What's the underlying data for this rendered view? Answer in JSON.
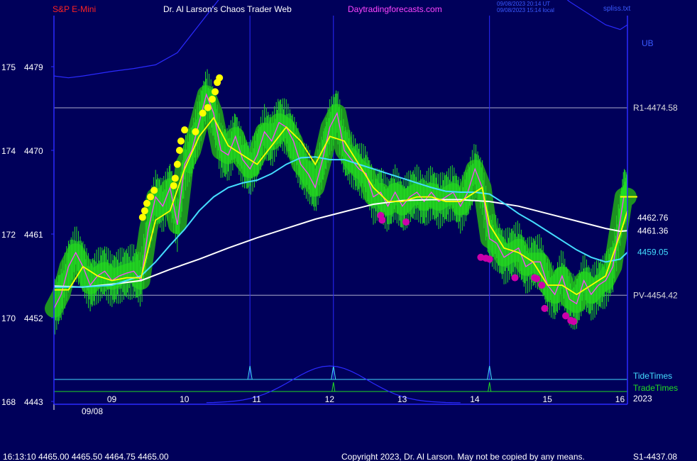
{
  "header": {
    "symbol": "S&P E-Mini",
    "site_title": "Dr. Al Larson's Chaos Trader Web",
    "site_url": "Daytradingforecasts.com",
    "timestamp_utc": "09/08/2023 20:14 UT",
    "timestamp_local": "09/08/2023 15:14 local",
    "file_name": "spliss.txt"
  },
  "footer": {
    "quote": "16:13:10  4465.00  4465.50  4464.75  4465.00",
    "copyright": "Copyright 2023, Dr. Al Larson. May not be copied by any means.",
    "s1_label": "S1-4437.08"
  },
  "colors": {
    "background": "#00005a",
    "frame": "#2a2aff",
    "green_band": "#1f9a1f",
    "price_bar": "#22dd22",
    "fast_ma": "#ffff00",
    "mid_ma": "#44ddff",
    "slow_ma": "#ffffff",
    "pink_ma": "#ff44ff",
    "yellow_dot": "#ffff00",
    "magenta_dot": "#cc00aa",
    "ub_line": "#2a2aff",
    "tide_line": "#44ddff",
    "trade_line": "#22dd22"
  },
  "chart_data": {
    "type": "line",
    "title": "S&P E-Mini",
    "xlabel": "",
    "ylabel": "",
    "date_label": "09/08",
    "year_label": "2023",
    "x_ticks": [
      "09",
      "10",
      "11",
      "12",
      "13",
      "14",
      "15",
      "16"
    ],
    "y_ticks": [
      {
        "left": "175",
        "right": "4479",
        "price": 4479
      },
      {
        "left": "174",
        "right": "4470",
        "price": 4470
      },
      {
        "left": "172",
        "right": "4461",
        "price": 4461
      },
      {
        "left": "170",
        "right": "4452",
        "price": 4452
      },
      {
        "left": "168",
        "right": "4443",
        "price": 4443
      }
    ],
    "ylim": [
      4443,
      4480.5
    ],
    "xlim": [
      8.2,
      16.1
    ],
    "levels": [
      {
        "label": "R1-4474.58",
        "price": 4474.58
      },
      {
        "label": "PV-4454.42",
        "price": 4454.42
      }
    ],
    "ma_labels": [
      {
        "label": "4462.76",
        "price": 4462.76,
        "color": "#ffffff"
      },
      {
        "label": "4461.36",
        "price": 4461.36,
        "color": "#ffffff"
      },
      {
        "label": "4459.05",
        "price": 4459.05,
        "color": "#44ddff"
      }
    ],
    "band_label": "UB",
    "tide_label": "TideTimes",
    "trade_label": "TradeTimes",
    "tide_times": [
      10.9,
      12.05,
      14.2
    ],
    "trade_times": [
      12.05,
      14.2
    ],
    "series": [
      {
        "name": "price",
        "x": [
          8.2,
          8.3,
          8.4,
          8.5,
          8.6,
          8.7,
          8.8,
          8.9,
          9.0,
          9.1,
          9.2,
          9.3,
          9.4,
          9.5,
          9.6,
          9.7,
          9.8,
          9.9,
          10.0,
          10.1,
          10.2,
          10.3,
          10.4,
          10.5,
          10.6,
          10.7,
          10.8,
          10.9,
          11.0,
          11.1,
          11.2,
          11.3,
          11.4,
          11.5,
          11.6,
          11.7,
          11.8,
          11.9,
          12.0,
          12.1,
          12.2,
          12.3,
          12.4,
          12.5,
          12.6,
          12.7,
          12.8,
          12.9,
          13.0,
          13.1,
          13.2,
          13.3,
          13.4,
          13.5,
          13.6,
          13.7,
          13.8,
          13.9,
          14.0,
          14.1,
          14.2,
          14.3,
          14.4,
          14.5,
          14.6,
          14.7,
          14.8,
          14.9,
          15.0,
          15.1,
          15.2,
          15.3,
          15.4,
          15.5,
          15.6,
          15.7,
          15.8,
          15.9,
          16.0,
          16.05,
          16.1
        ],
        "y": [
          4453,
          4454.5,
          4457.5,
          4459,
          4457.5,
          4455.5,
          4456.5,
          4457,
          4456,
          4456.5,
          4456.8,
          4457,
          4456,
          4461.5,
          4465,
          4464,
          4466,
          4462,
          4468.5,
          4470,
          4473,
          4476,
          4474,
          4470,
          4469.5,
          4471.5,
          4469,
          4468,
          4469.5,
          4472,
          4471,
          4473,
          4472.5,
          4471,
          4468.5,
          4467.5,
          4466,
          4469,
          4472.5,
          4474,
          4470,
          4469,
          4468,
          4467.5,
          4465,
          4465.5,
          4464,
          4465.5,
          4464,
          4465,
          4465.5,
          4464.5,
          4465.5,
          4464.5,
          4465,
          4465.5,
          4464,
          4465.5,
          4468,
          4466,
          4460.5,
          4460,
          4458.5,
          4459,
          4459.5,
          4457.5,
          4458,
          4458,
          4455.5,
          4454.5,
          4456.5,
          4454,
          4453.5,
          4456,
          4454.5,
          4455.5,
          4456,
          4457.5,
          4462.5,
          4465,
          4465
        ],
        "color": "#22dd22"
      },
      {
        "name": "fast_ma",
        "x": [
          8.2,
          8.4,
          8.6,
          8.8,
          9.0,
          9.2,
          9.4,
          9.6,
          9.8,
          10.0,
          10.2,
          10.4,
          10.6,
          10.8,
          11.0,
          11.2,
          11.4,
          11.6,
          11.8,
          12.0,
          12.2,
          12.4,
          12.6,
          12.8,
          13.0,
          13.2,
          13.4,
          13.6,
          13.8,
          14.0,
          14.1,
          14.2,
          14.4,
          14.6,
          14.8,
          15.0,
          15.2,
          15.4,
          15.6,
          15.8,
          16.0,
          16.1
        ],
        "y": [
          4455,
          4455,
          4457.5,
          4456.5,
          4456,
          4456.3,
          4456.3,
          4462.5,
          4463.5,
          4468,
          4471.5,
          4473.5,
          4470.5,
          4469.5,
          4468.5,
          4470.5,
          4472.5,
          4471,
          4468.5,
          4471.5,
          4471,
          4468.5,
          4466,
          4464.5,
          4464.5,
          4465,
          4465,
          4464.5,
          4464.5,
          4465.5,
          4466,
          4462,
          4459.5,
          4459,
          4458,
          4455.5,
          4455.5,
          4454.5,
          4455.5,
          4456.5,
          4461,
          4463.5
        ],
        "color": "#ffff00"
      },
      {
        "name": "mid_ma",
        "x": [
          8.2,
          8.6,
          9.0,
          9.4,
          9.6,
          9.8,
          10.0,
          10.2,
          10.4,
          10.6,
          10.8,
          11.0,
          11.2,
          11.4,
          11.6,
          11.8,
          12.0,
          12.2,
          12.4,
          12.6,
          12.8,
          13.0,
          13.2,
          13.4,
          13.6,
          13.8,
          14.0,
          14.2,
          14.4,
          14.6,
          14.8,
          15.0,
          15.2,
          15.4,
          15.6,
          15.8,
          16.0,
          16.1
        ],
        "y": [
          4455.3,
          4455.3,
          4455.5,
          4456.5,
          4458,
          4459.8,
          4461.5,
          4463.5,
          4465,
          4466,
          4466.5,
          4466.8,
          4467.5,
          4468.5,
          4469.2,
          4469.3,
          4469,
          4469,
          4468.5,
          4468,
          4467.5,
          4467,
          4466.5,
          4466,
          4465.6,
          4465.5,
          4465.5,
          4465.3,
          4464.3,
          4463.2,
          4462.3,
          4461.3,
          4460.3,
          4459.3,
          4458.5,
          4458,
          4458.3,
          4459.05
        ],
        "color": "#44ddff"
      },
      {
        "name": "slow_ma",
        "x": [
          8.2,
          8.6,
          9.0,
          9.4,
          9.8,
          10.2,
          10.6,
          11.0,
          11.4,
          11.8,
          12.2,
          12.6,
          13.0,
          13.4,
          13.8,
          14.2,
          14.6,
          15.0,
          15.4,
          15.8,
          16.0,
          16.1
        ],
        "y": [
          4455.4,
          4455.3,
          4455.6,
          4456,
          4457.2,
          4458.3,
          4459.5,
          4460.6,
          4461.6,
          4462.6,
          4463.4,
          4464.2,
          4464.6,
          4464.7,
          4464.7,
          4464.5,
          4464,
          4463.2,
          4462.4,
          4461.6,
          4461.3,
          4461.36
        ],
        "color": "#ffffff"
      },
      {
        "name": "ub",
        "x": [
          8.2,
          8.4,
          8.6,
          9.0,
          9.3,
          9.6,
          9.9,
          10.1,
          10.3,
          10.5,
          10.8,
          11.1,
          11.4,
          11.7,
          12.0,
          12.3,
          12.6,
          12.9,
          13.2,
          13.5,
          13.8,
          14.1,
          14.4,
          14.7,
          15.0,
          15.3,
          15.6,
          15.8,
          16.0,
          16.1
        ],
        "y": [
          4478,
          4477.8,
          4478,
          4478.5,
          4478.8,
          4479.2,
          4480.5,
          4482.5,
          4484.5,
          4486.5,
          4489,
          4490.5,
          4491.5,
          4491.8,
          4492,
          4491.8,
          4491.5,
          4491.2,
          4491,
          4490.8,
          4490.6,
          4490.5,
          4490.3,
          4489.5,
          4488,
          4486,
          4484.5,
          4483.5,
          4483,
          4483.5
        ],
        "color": "#2a2aff"
      }
    ],
    "yellow_dots": [
      {
        "x": 9.42,
        "y": 4462.8
      },
      {
        "x": 9.45,
        "y": 4463.5
      },
      {
        "x": 9.48,
        "y": 4464.3
      },
      {
        "x": 9.53,
        "y": 4465
      },
      {
        "x": 9.58,
        "y": 4465.7
      },
      {
        "x": 9.85,
        "y": 4466.2
      },
      {
        "x": 9.87,
        "y": 4467
      },
      {
        "x": 9.9,
        "y": 4468.5
      },
      {
        "x": 9.93,
        "y": 4470
      },
      {
        "x": 9.95,
        "y": 4471
      },
      {
        "x": 10.0,
        "y": 4472.2
      },
      {
        "x": 10.15,
        "y": 4472
      },
      {
        "x": 10.25,
        "y": 4474
      },
      {
        "x": 10.32,
        "y": 4474.6
      },
      {
        "x": 10.38,
        "y": 4475.5
      },
      {
        "x": 10.42,
        "y": 4476.3
      },
      {
        "x": 10.45,
        "y": 4477.3
      },
      {
        "x": 10.48,
        "y": 4477.8
      }
    ],
    "magenta_dots": [
      {
        "x": 12.7,
        "y": 4463
      },
      {
        "x": 12.72,
        "y": 4462.5
      },
      {
        "x": 13.05,
        "y": 4462.3
      },
      {
        "x": 14.08,
        "y": 4458.5
      },
      {
        "x": 14.15,
        "y": 4458.4
      },
      {
        "x": 14.2,
        "y": 4458.3
      },
      {
        "x": 14.55,
        "y": 4456.3
      },
      {
        "x": 14.82,
        "y": 4456.3
      },
      {
        "x": 14.85,
        "y": 4456.2
      },
      {
        "x": 14.92,
        "y": 4455.5
      },
      {
        "x": 14.96,
        "y": 4453
      },
      {
        "x": 15.25,
        "y": 4452.2
      },
      {
        "x": 15.32,
        "y": 4451.7
      },
      {
        "x": 15.36,
        "y": 4451.6
      }
    ]
  }
}
